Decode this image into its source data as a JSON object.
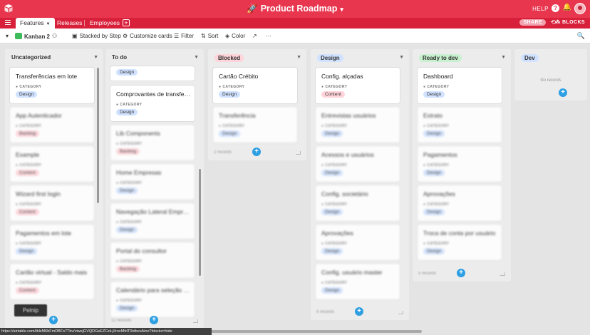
{
  "header": {
    "title": "Product Roadmap",
    "title_icon": "rocket-icon",
    "help": "HELP",
    "brand_color": "#e8364e"
  },
  "tabs": {
    "active": "Features",
    "items": [
      "Releases",
      "Employees"
    ]
  },
  "share": "SHARE",
  "blocks": "BLOCKS",
  "toolbar": {
    "view_name": "Kanban 2",
    "stacked_by": "Stacked by Step",
    "customize": "Customize cards",
    "filter": "Filter",
    "sort": "Sort",
    "color": "Color",
    "more": "···"
  },
  "field_label": "CATEGORY",
  "columns": [
    {
      "title": "Uncategorized",
      "pill_color": "",
      "cards": [
        {
          "title": "Transferências em lote",
          "tag": "Design",
          "tag_color": "#d0e2ff",
          "blur": false
        },
        {
          "title": "App Autenticador",
          "tag": "Backlog",
          "tag_color": "#ffd4da",
          "blur": true
        },
        {
          "title": "Example",
          "tag": "Content",
          "tag_color": "#ffd4da",
          "blur": true
        },
        {
          "title": "Wizard first login",
          "tag": "Content",
          "tag_color": "#ffd4da",
          "blur": true
        },
        {
          "title": "Pagamentos em lote",
          "tag": "Design",
          "tag_color": "#d0e2ff",
          "blur": true
        },
        {
          "title": "Cartão virtual - Saldo mais",
          "tag": "Content",
          "tag_color": "#ffd4da",
          "blur": true
        }
      ],
      "footer": ""
    },
    {
      "title": "To do",
      "pill_color": "",
      "cards": [
        {
          "title": "",
          "tag": "Design",
          "tag_color": "#d0e2ff",
          "blur": false,
          "partial": true
        },
        {
          "title": "Comprovantes de transferência",
          "tag": "Design",
          "tag_color": "#d0e2ff",
          "blur": false
        },
        {
          "title": "Lib Components",
          "tag": "Backlog",
          "tag_color": "#ffd4da",
          "blur": true
        },
        {
          "title": "Home Empresas",
          "tag": "Design",
          "tag_color": "#d0e2ff",
          "blur": true
        },
        {
          "title": "Navegação Lateral Empresas",
          "tag": "Design",
          "tag_color": "#d0e2ff",
          "blur": true
        },
        {
          "title": "Portal do consultor",
          "tag": "Backlog",
          "tag_color": "#ffd4da",
          "blur": true
        },
        {
          "title": "Calendário para seleção de datas",
          "tag": "Design",
          "tag_color": "#d0e2ff",
          "blur": true
        }
      ],
      "footer": "12 records"
    },
    {
      "title": "Blocked",
      "pill_color": "#ffd4da",
      "cards": [
        {
          "title": "Cartão Crébito",
          "tag": "Design",
          "tag_color": "#d0e2ff",
          "blur": false
        },
        {
          "title": "Transferência",
          "tag": "Design",
          "tag_color": "#d0e2ff",
          "blur": true
        }
      ],
      "footer": "2 records"
    },
    {
      "title": "Design",
      "pill_color": "#d0e2ff",
      "cards": [
        {
          "title": "Config. alçadas",
          "tag": "Content",
          "tag_color": "#ffd4da",
          "blur": false
        },
        {
          "title": "Entrevistas usuários",
          "tag": "Design",
          "tag_color": "#d0e2ff",
          "blur": true
        },
        {
          "title": "Acessos e usuários",
          "tag": "Design",
          "tag_color": "#d0e2ff",
          "blur": true
        },
        {
          "title": "Config. societário",
          "tag": "Design",
          "tag_color": "#d0e2ff",
          "blur": true
        },
        {
          "title": "Aprovações",
          "tag": "Design",
          "tag_color": "#d0e2ff",
          "blur": true
        },
        {
          "title": "Config. usuário master",
          "tag": "Design",
          "tag_color": "#d0e2ff",
          "blur": true
        }
      ],
      "footer": "6 records"
    },
    {
      "title": "Ready to dev",
      "pill_color": "#c8f0cf",
      "cards": [
        {
          "title": "Dashboard",
          "tag": "Design",
          "tag_color": "#d0e2ff",
          "blur": false
        },
        {
          "title": "Extrato",
          "tag": "Design",
          "tag_color": "#d0e2ff",
          "blur": true
        },
        {
          "title": "Pagamentos",
          "tag": "Design",
          "tag_color": "#d0e2ff",
          "blur": true
        },
        {
          "title": "Aprovações",
          "tag": "Design",
          "tag_color": "#d0e2ff",
          "blur": true
        },
        {
          "title": "Troca de conta por usuário",
          "tag": "Design",
          "tag_color": "#d0e2ff",
          "blur": true
        }
      ],
      "footer": "5 records"
    },
    {
      "title": "Dev",
      "pill_color": "#d0e2ff",
      "cards": [],
      "empty_text": "No records",
      "footer": ""
    }
  ],
  "tooltip": "Pelnip",
  "status_url": "https://airtable.com/tblzM6bFmDBFs7Tbv/viwejGVQDGsEZCzk.jl/recMfdT0stbvuAino?blocks=hide"
}
